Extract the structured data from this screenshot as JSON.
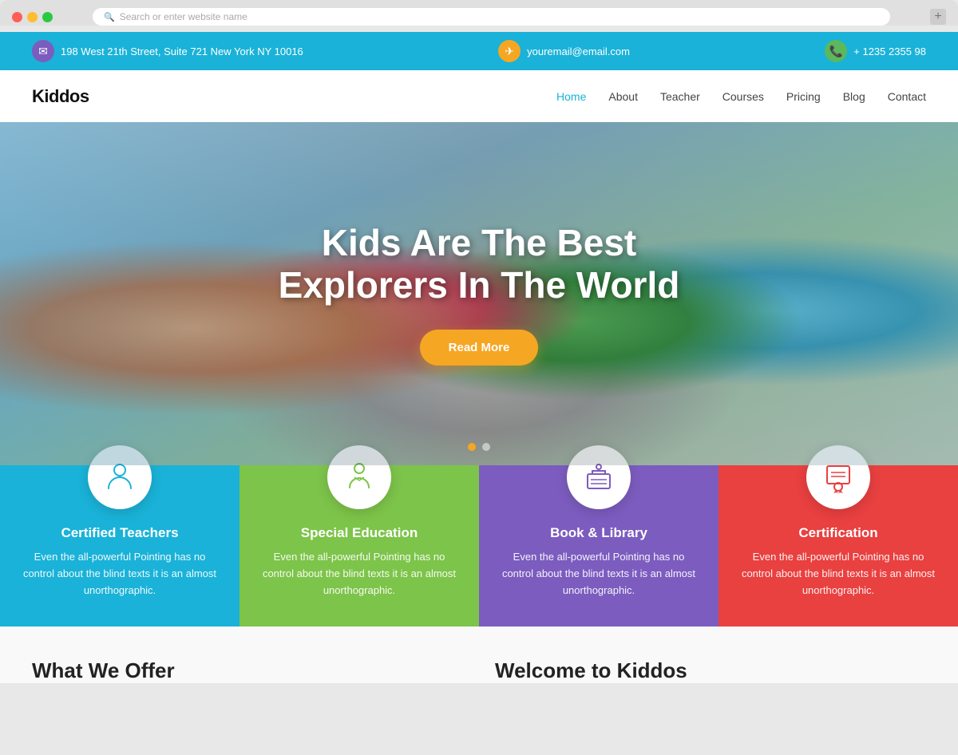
{
  "browser": {
    "address_placeholder": "Search or enter website name",
    "new_tab_label": "+"
  },
  "topbar": {
    "address": "198 West 21th Street, Suite 721 New York NY 10016",
    "email": "youremail@email.com",
    "phone": "+ 1235 2355 98"
  },
  "nav": {
    "logo": "Kiddos",
    "links": [
      {
        "label": "Home",
        "active": true
      },
      {
        "label": "About",
        "active": false
      },
      {
        "label": "Teacher",
        "active": false
      },
      {
        "label": "Courses",
        "active": false
      },
      {
        "label": "Pricing",
        "active": false
      },
      {
        "label": "Blog",
        "active": false
      },
      {
        "label": "Contact",
        "active": false
      }
    ]
  },
  "hero": {
    "title_line1": "Kids Are The Best",
    "title_line2": "Explorers In The World",
    "cta_label": "Read More"
  },
  "features": [
    {
      "title": "Certified Teachers",
      "desc": "Even the all-powerful Pointing has no control about the blind texts it is an almost unorthographic.",
      "icon": "👩‍🏫",
      "color": "#1ab2d8"
    },
    {
      "title": "Special Education",
      "desc": "Even the all-powerful Pointing has no control about the blind texts it is an almost unorthographic.",
      "icon": "👨‍🎓",
      "color": "#7dc44a"
    },
    {
      "title": "Book & Library",
      "desc": "Even the all-powerful Pointing has no control about the blind texts it is an almost unorthographic.",
      "icon": "📚",
      "color": "#7c5cbf"
    },
    {
      "title": "Certification",
      "desc": "Even the all-powerful Pointing has no control about the blind texts it is an almost unorthographic.",
      "icon": "📜",
      "color": "#e94040"
    }
  ],
  "bottom": {
    "heading1": "What We Offer",
    "heading2": "Welcome to Kiddos"
  }
}
